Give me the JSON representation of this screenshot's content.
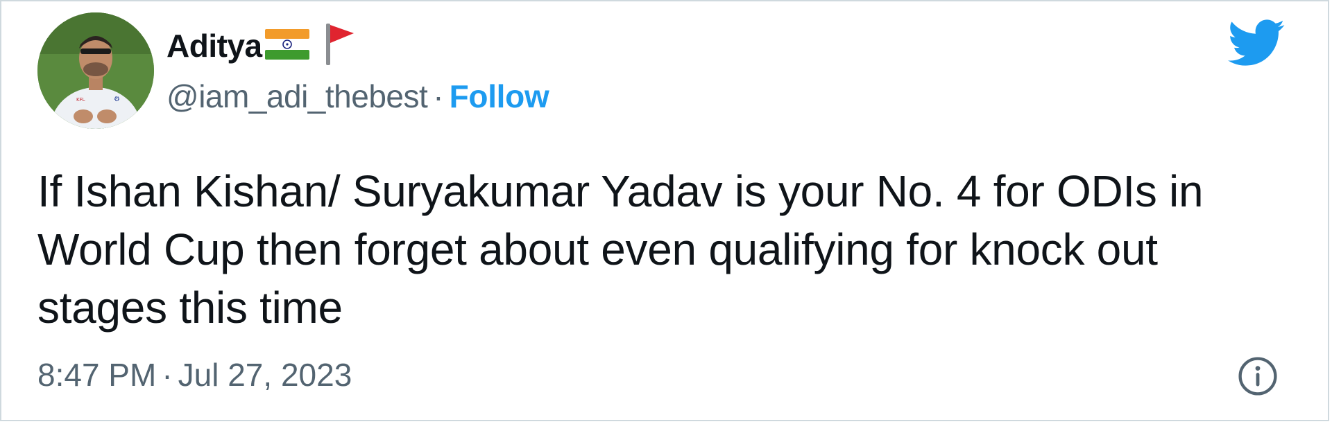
{
  "author": {
    "display_name": "Aditya",
    "handle": "@iam_adi_thebest",
    "separator": "·",
    "follow_label": "Follow"
  },
  "tweet": {
    "text": "If Ishan Kishan/ Suryakumar Yadav is your No. 4 for ODIs in World Cup then forget about even qualifying for knock out stages this time",
    "time": "8:47 PM",
    "separator": "·",
    "date": "Jul 27, 2023"
  },
  "icons": {
    "brand": "twitter-bird-icon",
    "info": "info-icon",
    "emoji_1": "india-flag-icon",
    "emoji_2": "red-flag-icon"
  },
  "colors": {
    "accent": "#1d9bf0",
    "text_primary": "#0f1419",
    "text_secondary": "#536471",
    "border": "#cfd9de"
  }
}
